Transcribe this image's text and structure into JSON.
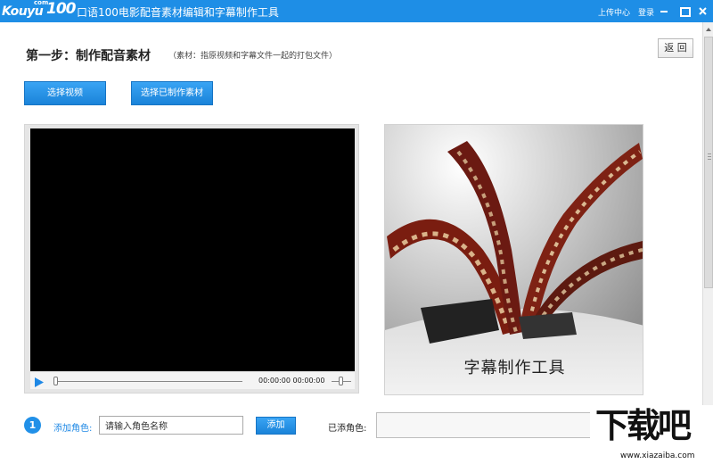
{
  "titlebar": {
    "logo_main": "Kouyu",
    "logo_com": "com",
    "logo_num": "100",
    "title": "口语100电影配音素材编辑和字幕制作工具",
    "upload_center": "上传中心",
    "login": "登录"
  },
  "header": {
    "step_title": "第一步：制作配音素材",
    "step_note": "（素材：指原视频和字幕文件一起的打包文件）",
    "back_label": "返 回"
  },
  "actions": {
    "select_video": "选择视频",
    "select_material": "选择已制作素材"
  },
  "player": {
    "time": "00:00:00 00:00:00",
    "progress": 0
  },
  "banner": {
    "caption": "字幕制作工具"
  },
  "role": {
    "step_number": "1",
    "label": "添加角色:",
    "input_value": "请输入角色名称",
    "add_label": "添加",
    "added_label": "已添角色:"
  },
  "watermark": {
    "main": "下载吧",
    "url": "www.xiazaiba.com"
  },
  "colors": {
    "titlebar": "#1e8ee6",
    "accent": "#1e88e5",
    "button": "#1a83d9"
  }
}
